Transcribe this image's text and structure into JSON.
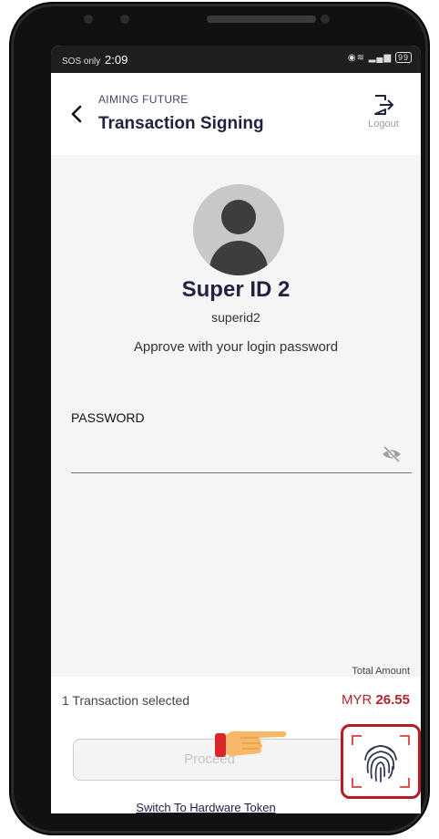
{
  "status_bar": {
    "carrier": "SOS only",
    "time": "2:09",
    "battery": "99"
  },
  "header": {
    "org": "AIMING FUTURE",
    "title": "Transaction Signing",
    "logout_label": "Logout"
  },
  "user": {
    "display_name": "Super ID 2",
    "user_id": "superid2",
    "instruction": "Approve with your login password"
  },
  "password": {
    "label": "PASSWORD",
    "value": ""
  },
  "summary": {
    "total_label": "Total Amount",
    "selected_text": "1 Transaction selected",
    "currency": "MYR",
    "amount": "26.55"
  },
  "actions": {
    "proceed_label": "Proceed",
    "switch_label": "Switch To Hardware Token"
  },
  "icons": [
    "back-arrow-icon",
    "logout-icon",
    "avatar-icon",
    "eye-slash-icon",
    "fingerprint-icon",
    "pointing-hand-icon"
  ],
  "colors": {
    "accent_red": "#b3232c",
    "title_navy": "#1f2340"
  }
}
